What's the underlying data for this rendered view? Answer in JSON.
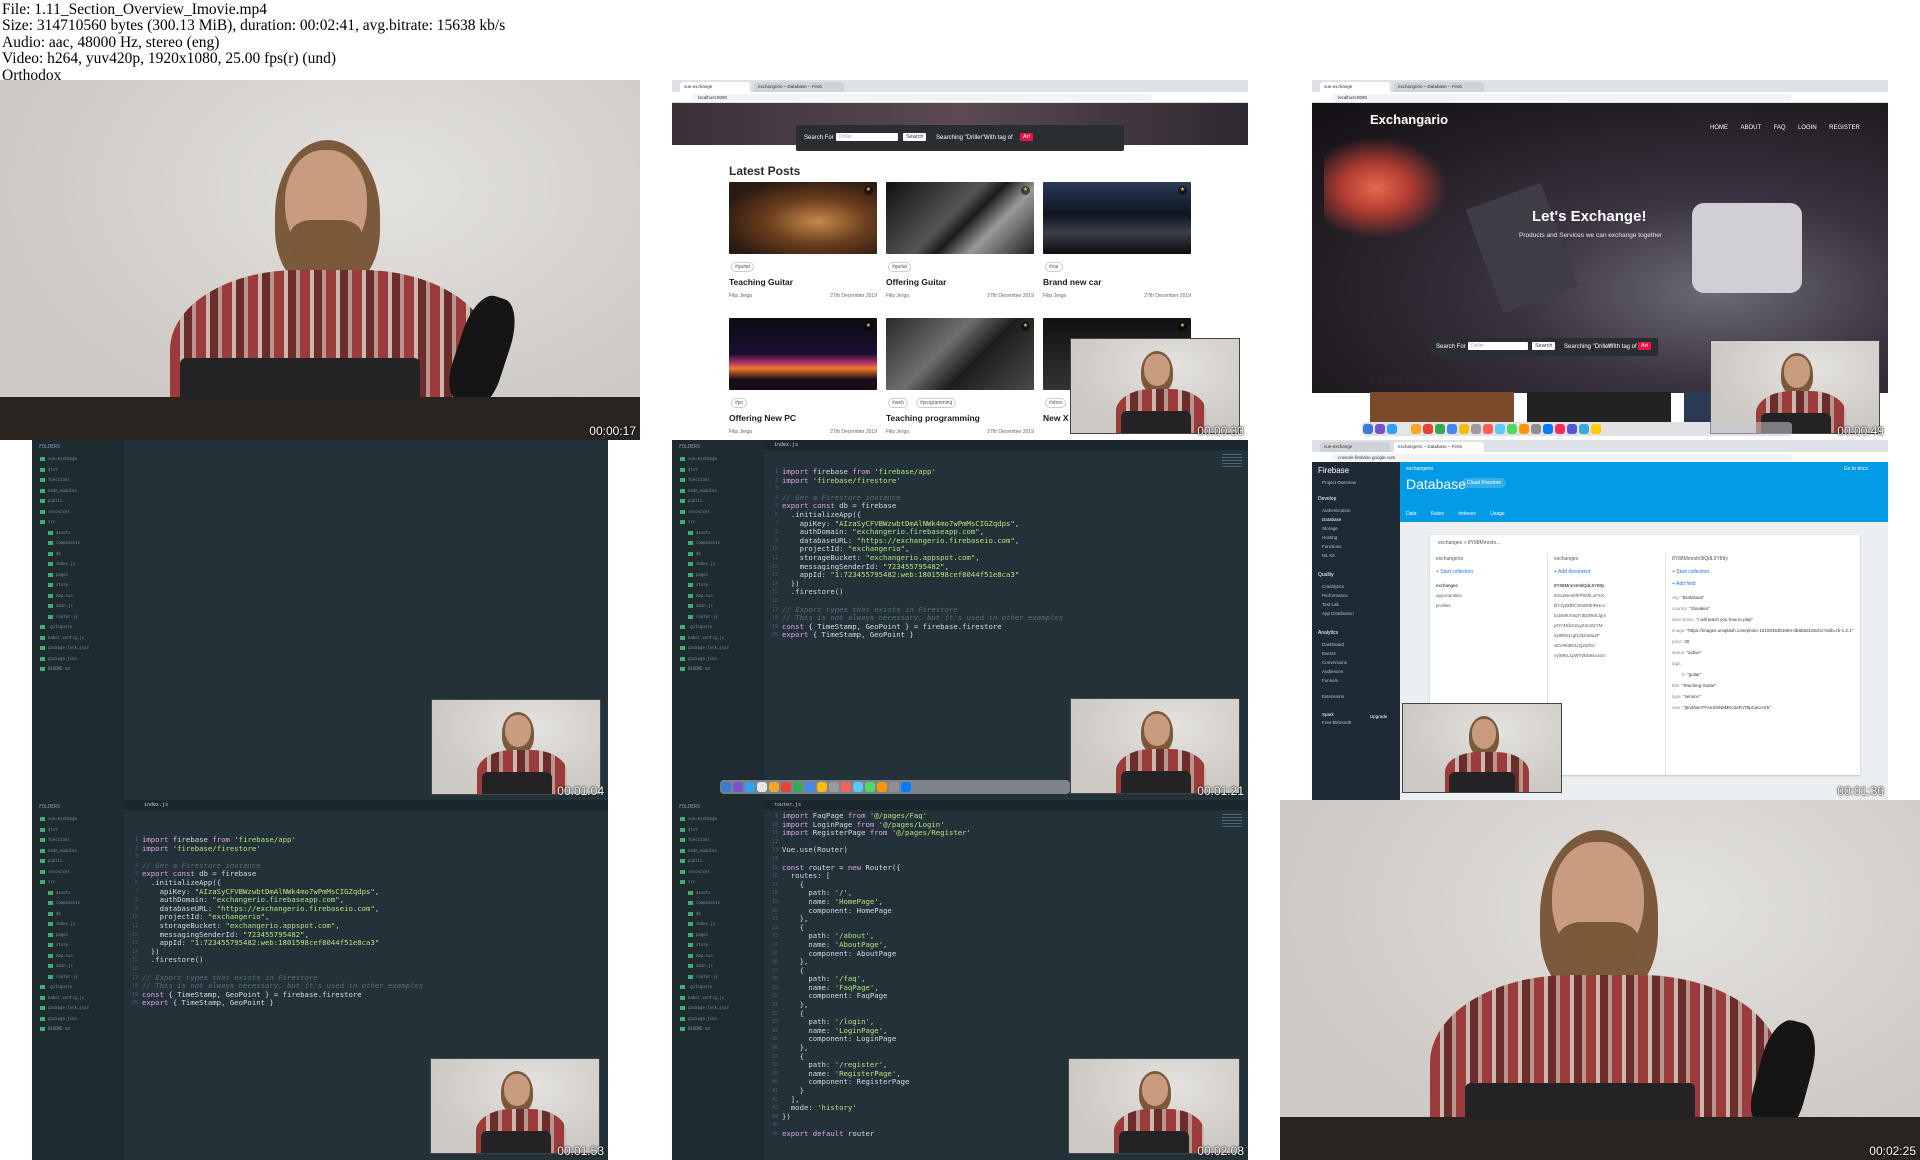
{
  "header": {
    "file_line": "File: 1.11_Section_Overview_Imovie.mp4",
    "size_line": "Size: 314710560 bytes (300.13 MiB), duration: 00:02:41, avg.bitrate: 15638 kb/s",
    "audio_line": "Audio: aac, 48000 Hz, stereo (eng)",
    "video_line": "Video: h264, yuv420p, 1920x1080, 25.00 fps(r) (und)",
    "tag_line": "Orthodox"
  },
  "timestamps": [
    "00:00:17",
    "00:00:33",
    "00:00:49",
    "00:01:04",
    "00:01:21",
    "00:01:36",
    "00:01:53",
    "00:02:08",
    "00:02:25"
  ],
  "browser": {
    "tab1": "vue-exchange",
    "tab2": "exchangerio – Database – Fireb",
    "url": "localhost:8080",
    "search": {
      "label": "Search For",
      "placeholder": "Driller",
      "button": "Search",
      "searching": "Searching \"Driller\"",
      "with_tag": "With tag of",
      "tag": "Art"
    },
    "latest_posts": "Latest Posts",
    "posts": [
      {
        "tag": "#guitar",
        "title": "Teaching Guitar",
        "author": "Filip Jerga",
        "date": "27th December 2019"
      },
      {
        "tag": "#guitar",
        "title": "Offering Guitar",
        "author": "Filip Jerga",
        "date": "27th December 2019"
      },
      {
        "tag": "#car",
        "title": "Brand new car",
        "author": "Filip Jerga",
        "date": "27th December 2019"
      },
      {
        "tag": "#pc",
        "title": "Offering New PC",
        "author": "Filip Jerga",
        "date": "27th December 2019"
      },
      {
        "tag": "#web",
        "tag2": "#programming",
        "title": "Teaching programming",
        "author": "Filip Jerga",
        "date": "27th December 2019"
      },
      {
        "tag": "#xbox",
        "title": "New X",
        "author": "Filip Jerga",
        "date": ""
      }
    ]
  },
  "hero": {
    "brand": "Exchangario",
    "nav": [
      "HOME",
      "ABOUT",
      "FAQ",
      "LOGIN",
      "REGISTER"
    ],
    "title": "Let's Exchange!",
    "subtitle": "Products and Services we can exchange together",
    "latest_posts": "Latest Posts"
  },
  "editor": {
    "folders_label": "FOLDERS",
    "tab_file": "index.js",
    "tree": [
      "vue-exchange",
      "dist",
      "functions",
      "node_modules",
      "public",
      "resources",
      "src",
      "assets",
      "components",
      "db",
      "index.js",
      "pages",
      "store",
      "App.vue",
      "main.js",
      "router.js",
      ".gitignore",
      "babel.config.js",
      "package-lock.json",
      "package.json",
      "README.md"
    ],
    "firebase_code": [
      "import firebase from 'firebase/app'",
      "import 'firebase/firestore'",
      "",
      "// Get a Firestore instance",
      "export const db = firebase",
      "  .initializeApp({",
      "    apiKey: \"AIzaSyCFVBWzwbtDmAlNWk4mo7wPmMsCIGZqdps\",",
      "    authDomain: \"exchangerio.firebaseapp.com\",",
      "    databaseURL: \"https://exchangerio.firebaseio.com\",",
      "    projectId: \"exchangerio\",",
      "    storageBucket: \"exchangerio.appspot.com\",",
      "    messagingSenderId: \"723455795482\",",
      "    appId: \"1:723455795482:web:1801598cef8044f51e8ca3\"",
      "  })",
      "  .firestore()",
      "",
      "// Export types that exists in Firestore",
      "// This is not always necessary, but it's used in other examples",
      "const { TimeStamp, GeoPoint } = firebase.firestore",
      "export { TimeStamp, GeoPoint }"
    ],
    "router_code": [
      "import FaqPage from '@/pages/Faq'",
      "import LoginPage from '@/pages/Login'",
      "import RegisterPage from '@/pages/Register'",
      "",
      "Vue.use(Router)",
      "",
      "const router = new Router({",
      "  routes: [",
      "    {",
      "      path: '/',",
      "      name: 'HomePage',",
      "      component: HomePage",
      "    },",
      "    {",
      "      path: '/about',",
      "      name: 'AboutPage',",
      "      component: AboutPage",
      "    },",
      "    {",
      "      path: '/faq',",
      "      name: 'FaqPage',",
      "      component: FaqPage",
      "    },",
      "    {",
      "      path: '/login',",
      "      name: 'LoginPage',",
      "      component: LoginPage",
      "    },",
      "    {",
      "      path: '/register',",
      "      name: 'RegisterPage',",
      "      component: RegisterPage",
      "    }",
      "  ],",
      "  mode: 'history'",
      "})",
      "",
      "export default router"
    ]
  },
  "firebase": {
    "logo": "Firebase",
    "project_overview": "Project Overview",
    "develop": "Develop",
    "develop_items": [
      "Authentication",
      "Database",
      "Storage",
      "Hosting",
      "Functions",
      "ML Kit"
    ],
    "quality": "Quality",
    "quality_items": [
      "Crashlytics",
      "Performance",
      "Test Lab",
      "App Distribution"
    ],
    "analytics": "Analytics",
    "analytics_items": [
      "Dashboard",
      "Events",
      "Conversions",
      "Audiences",
      "Funnels"
    ],
    "extensions": "Extensions",
    "plan": "Spark",
    "plan_sub": "Free $0/month",
    "upgrade": "Upgrade",
    "project": "exchangerio",
    "title": "Database",
    "db_pill": "Cloud Firestore",
    "tabs": [
      "Data",
      "Rules",
      "Indexes",
      "Usage"
    ],
    "go_to_docs": "Go to docs",
    "breadcrumb": "exchanges  >  8Y88Mmrstn...",
    "col1_header": "exchangerio",
    "col2_header": "exchanges",
    "col3_header": "8Y88Mmrstn9lQdL9Y8tty",
    "start_collection": "+ Start collection",
    "add_document": "+ Add document",
    "add_field": "+ Add field",
    "collections": [
      "exchanges",
      "opportunities",
      "profiles"
    ],
    "documents": [
      "8Y88Mmrstn9lQdL9Y8tty",
      "8Oo2Ne40hPf9XfiLuFXX",
      "BY1yZkfDC9X8R9hRHcx",
      "bLBMKm9qTnBDRMLfgm",
      "pOY4SfszZuyZ4r4dzYM",
      "sy8tRb4cgf1Zt2uMuZF",
      "sDV8M5D1rZj2t2fGc",
      "vytWKL1pWT0Eb9sxoSm"
    ],
    "fields": [
      {
        "k": "city",
        "v": "\"Bratislava\""
      },
      {
        "k": "country",
        "v": "\"Slovakia\""
      },
      {
        "k": "description",
        "v": "\"I will teach you how to play\""
      },
      {
        "k": "image",
        "v": "\"https://images.unsplash.com/photo-1510915361894-db8b60106cb1?ixlib=rb-1.2.1\""
      },
      {
        "k": "price",
        "v": "20"
      },
      {
        "k": "status",
        "v": "\"active\""
      },
      {
        "k": "tags",
        "v": ""
      },
      {
        "k": "0",
        "v": "\"guitar\""
      },
      {
        "k": "title",
        "v": "\"Teaching Guitar\""
      },
      {
        "k": "type",
        "v": "\"service\""
      },
      {
        "k": "user",
        "v": "\"j6n4NeuTFAeXi5N8MKc3aFnT8pCwcHV5\""
      }
    ]
  },
  "colors": {
    "editor_bg": "#233238",
    "accent_pink": "#e8124a",
    "firebase_blue": "#039be5",
    "firebase_nav": "#1e2a36"
  }
}
